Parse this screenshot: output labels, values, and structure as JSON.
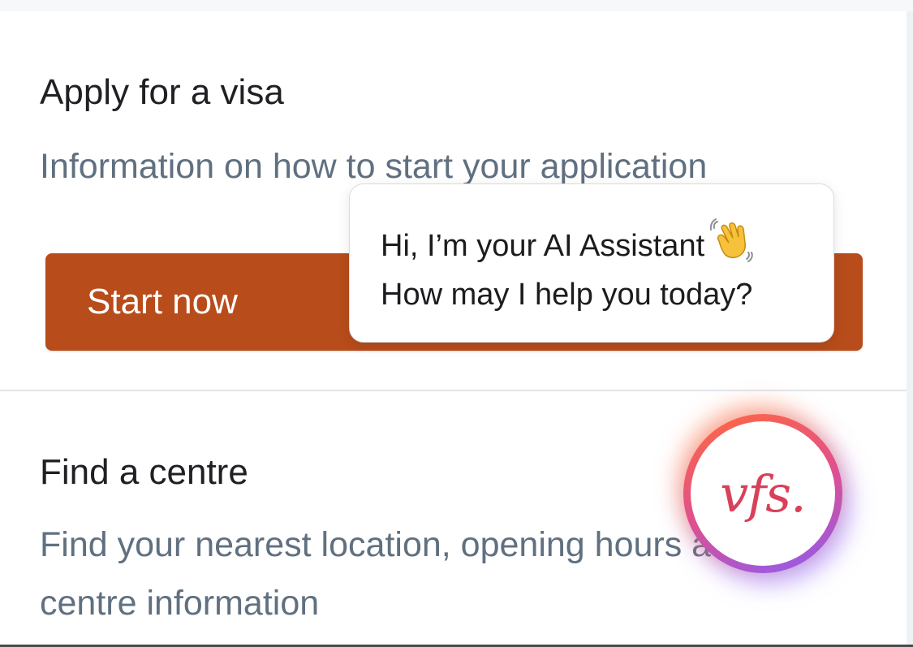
{
  "visa_card": {
    "title": "Apply for a visa",
    "description": "Information on how to start your application",
    "button_label": "Start now"
  },
  "centre_card": {
    "title": "Find a centre",
    "description": "Find your nearest location, opening hours and centre information"
  },
  "chat": {
    "greeting": "Hi, I’m your AI Assistant",
    "greeting_icon": "waving-hand-icon",
    "prompt": "How may I help you today?"
  },
  "launcher": {
    "logo_text": "vfs.",
    "icon": "vfs-logo-icon"
  },
  "colors": {
    "button_bg": "#b84c1b",
    "title_text": "#1f1f24",
    "description_text": "#607080",
    "logo": "#d9405a",
    "launcher_gradient_start": "#ff6a3d",
    "launcher_gradient_end": "#8b5cf6"
  }
}
